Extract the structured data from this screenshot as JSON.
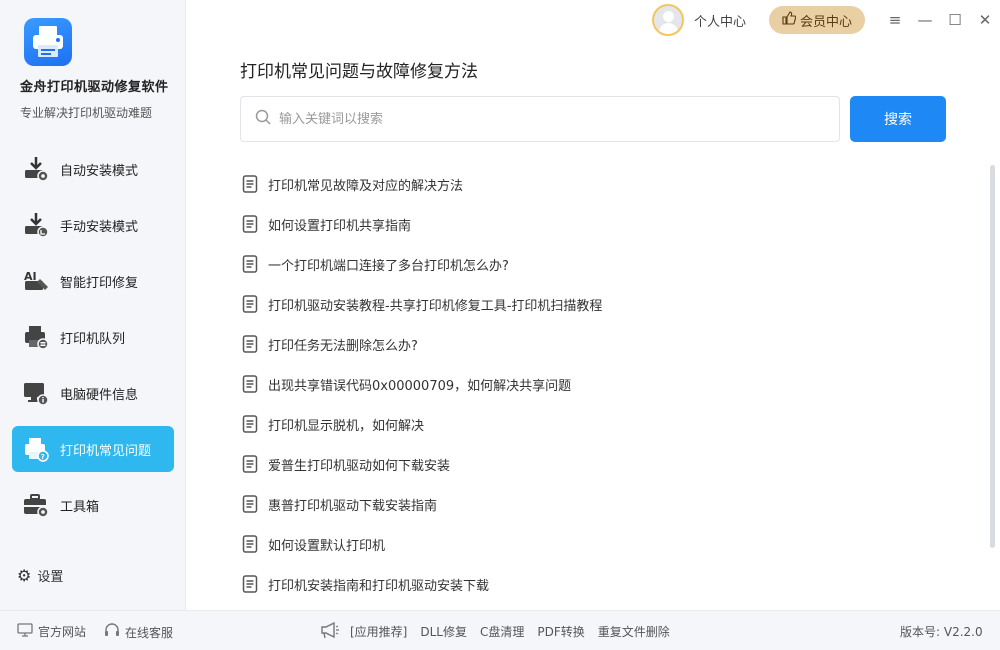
{
  "app": {
    "name": "金舟打印机驱动修复软件",
    "subtitle": "专业解决打印机驱动难题"
  },
  "sidebar": {
    "items": [
      {
        "label": "自动安装模式",
        "icon": "auto-install-icon"
      },
      {
        "label": "手动安装模式",
        "icon": "manual-install-icon"
      },
      {
        "label": "智能打印修复",
        "icon": "smart-repair-icon"
      },
      {
        "label": "打印机队列",
        "icon": "printer-queue-icon"
      },
      {
        "label": "电脑硬件信息",
        "icon": "hardware-info-icon"
      },
      {
        "label": "打印机常见问题",
        "icon": "printer-faq-icon",
        "active": true
      },
      {
        "label": "工具箱",
        "icon": "toolbox-icon"
      }
    ],
    "settings_label": "设置"
  },
  "topbar": {
    "personal_label": "个人中心",
    "vip_label": "会员中心"
  },
  "main": {
    "title": "打印机常见问题与故障修复方法",
    "search": {
      "placeholder": "输入关键词以搜索",
      "value": "",
      "button_label": "搜索"
    },
    "faq_items": [
      "打印机常见故障及对应的解决方法",
      "如何设置打印机共享指南",
      "一个打印机端口连接了多台打印机怎么办?",
      "打印机驱动安装教程-共享打印机修复工具-打印机扫描教程",
      "打印任务无法删除怎么办?",
      "出现共享错误代码0x00000709，如何解决共享问题",
      "打印机显示脱机，如何解决",
      "爱普生打印机驱动如何下载安装",
      "惠普打印机驱动下载安装指南",
      "如何设置默认打印机",
      "打印机安装指南和打印机驱动安装下载"
    ]
  },
  "footer": {
    "website_label": "官方网站",
    "service_label": "在线客服",
    "recommend_label": "[应用推荐]",
    "recommend_links": [
      "DLL修复",
      "C盘清理",
      "PDF转换",
      "重复文件删除"
    ],
    "version": "版本号: V2.2.0"
  },
  "colors": {
    "accent": "#1e88f5",
    "active_nav": "#2fb8ef",
    "vip_bg": "#e9cfa4"
  }
}
